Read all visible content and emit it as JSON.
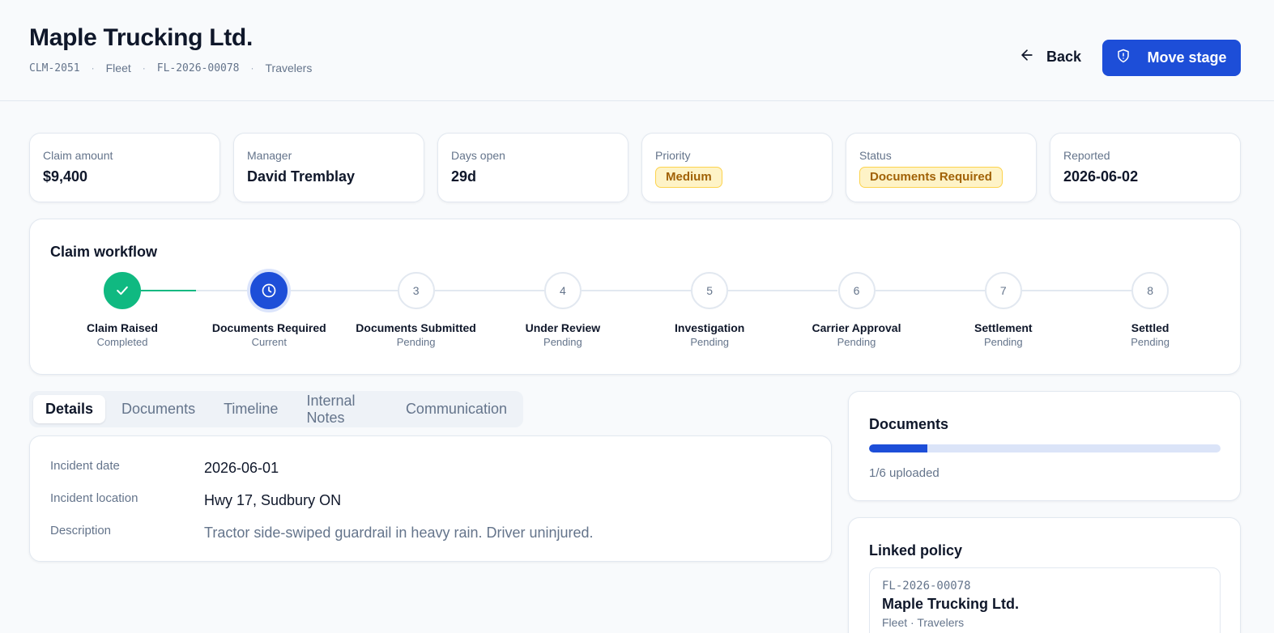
{
  "header": {
    "title": "Maple Trucking Ltd.",
    "claim_id": "CLM-2051",
    "line": "Fleet",
    "policy_number": "FL-2026-00078",
    "carrier": "Travelers",
    "separator": "·",
    "back_label": "Back",
    "move_stage_label": "Move stage"
  },
  "stats": [
    {
      "label": "Claim amount",
      "value": "$9,400"
    },
    {
      "label": "Manager",
      "value": "David Tremblay"
    },
    {
      "label": "Days open",
      "value": "29d"
    },
    {
      "label": "Priority",
      "value": "Medium"
    },
    {
      "label": "Status",
      "value": "Documents Required"
    },
    {
      "label": "Reported",
      "value": "2026-06-02"
    }
  ],
  "workflow": {
    "title": "Claim workflow",
    "steps": [
      {
        "number": "1",
        "name": "Claim Raised",
        "status": "Completed",
        "state": "done"
      },
      {
        "number": "2",
        "name": "Documents Required",
        "status": "Current",
        "state": "current"
      },
      {
        "number": "3",
        "name": "Documents Submitted",
        "status": "Pending",
        "state": "pending"
      },
      {
        "number": "4",
        "name": "Under Review",
        "status": "Pending",
        "state": "pending"
      },
      {
        "number": "5",
        "name": "Investigation",
        "status": "Pending",
        "state": "pending"
      },
      {
        "number": "6",
        "name": "Carrier Approval",
        "status": "Pending",
        "state": "pending"
      },
      {
        "number": "7",
        "name": "Settlement",
        "status": "Pending",
        "state": "pending"
      },
      {
        "number": "8",
        "name": "Settled",
        "status": "Pending",
        "state": "pending"
      }
    ]
  },
  "tabs": [
    {
      "label": "Details",
      "active": true
    },
    {
      "label": "Documents",
      "active": false
    },
    {
      "label": "Timeline",
      "active": false
    },
    {
      "label": "Internal Notes",
      "active": false
    },
    {
      "label": "Communication",
      "active": false
    }
  ],
  "details": {
    "incident_date_label": "Incident date",
    "incident_date": "2026-06-01",
    "incident_location_label": "Incident location",
    "incident_location": "Hwy 17, Sudbury ON",
    "description_label": "Description",
    "description": "Tractor side-swiped guardrail in heavy rain. Driver uninjured."
  },
  "documents": {
    "title": "Documents",
    "uploaded": 1,
    "total": 6,
    "progress_text": "1/6 uploaded"
  },
  "linked_policy": {
    "title": "Linked policy",
    "policy_number": "FL-2026-00078",
    "name": "Maple Trucking Ltd.",
    "meta": "Fleet · Travelers"
  },
  "colors": {
    "accent": "#1d4ed8",
    "success": "#10b981",
    "warning_bg": "#fef3c7",
    "warning_text": "#a16207"
  },
  "icons": {
    "back": "arrow-left-icon",
    "move_stage": "shield-icon",
    "completed_step": "check-icon",
    "current_step": "clock-icon"
  }
}
